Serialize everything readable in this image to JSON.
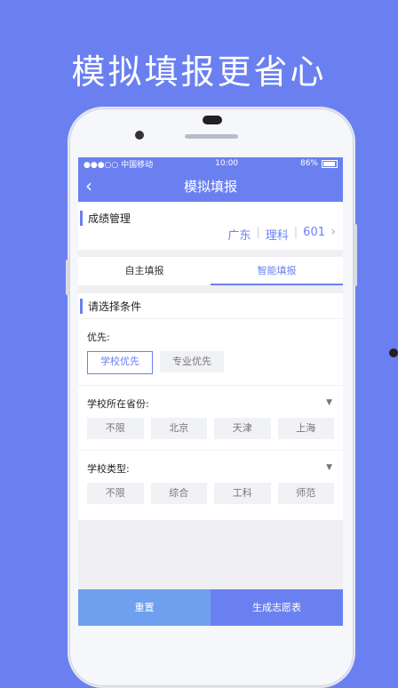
{
  "headline": "模拟填报更省心",
  "status": {
    "carrier": "●●●○○ 中国移动",
    "time": "10:00",
    "battery": "86%"
  },
  "nav": {
    "title": "模拟填报"
  },
  "score": {
    "section": "成绩管理",
    "province": "广东",
    "subject": "理科",
    "points": "601"
  },
  "tabs": [
    {
      "label": "自主填报"
    },
    {
      "label": "智能填报"
    }
  ],
  "conditions": {
    "section": "请选择条件",
    "priority": {
      "label": "优先:",
      "options": [
        "学校优先",
        "专业优先"
      ]
    },
    "province": {
      "label": "学校所在省份:",
      "options": [
        "不限",
        "北京",
        "天津",
        "上海"
      ]
    },
    "type": {
      "label": "学校类型:",
      "options": [
        "不限",
        "综合",
        "工科",
        "师范"
      ]
    }
  },
  "buttons": {
    "reset": "重置",
    "generate": "生成志愿表"
  },
  "colors": {
    "accent": "#6b80f0",
    "reset": "#6fa0ef"
  }
}
